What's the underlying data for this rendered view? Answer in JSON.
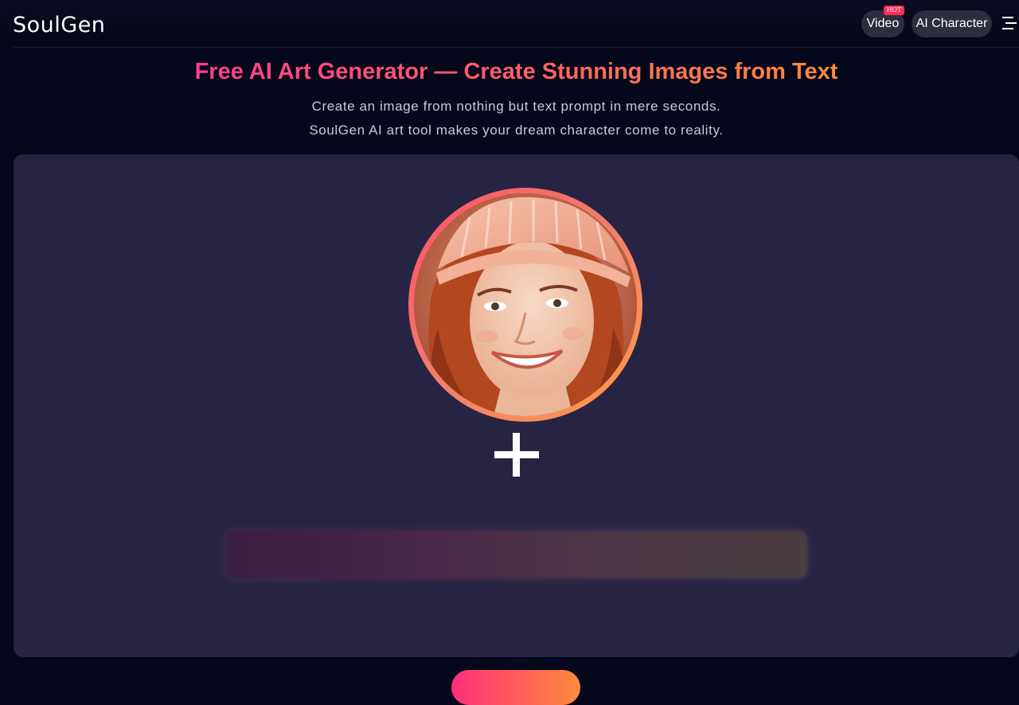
{
  "header": {
    "logo": "SoulGen",
    "nav": {
      "video_label": "Video",
      "video_badge": "HOT",
      "ai_character_label": "AI Character"
    },
    "menu_icon": "hamburger-menu-icon"
  },
  "hero": {
    "title": "Free AI Art Generator — Create Stunning Images from Text",
    "subtitle_line1": "Create an image from nothing but text prompt in mere seconds.",
    "subtitle_line2": "SoulGen AI art tool makes your dream character come to reality."
  },
  "demo": {
    "avatar_icon": "woman-portrait-avatar",
    "plus_icon": "plus-icon",
    "prompt_bar": ""
  },
  "colors": {
    "background": "#05071a",
    "card": "#272443",
    "accent_start": "#ff3f8e",
    "accent_end": "#ff8a3c",
    "hot_badge": "#ff2d55"
  }
}
